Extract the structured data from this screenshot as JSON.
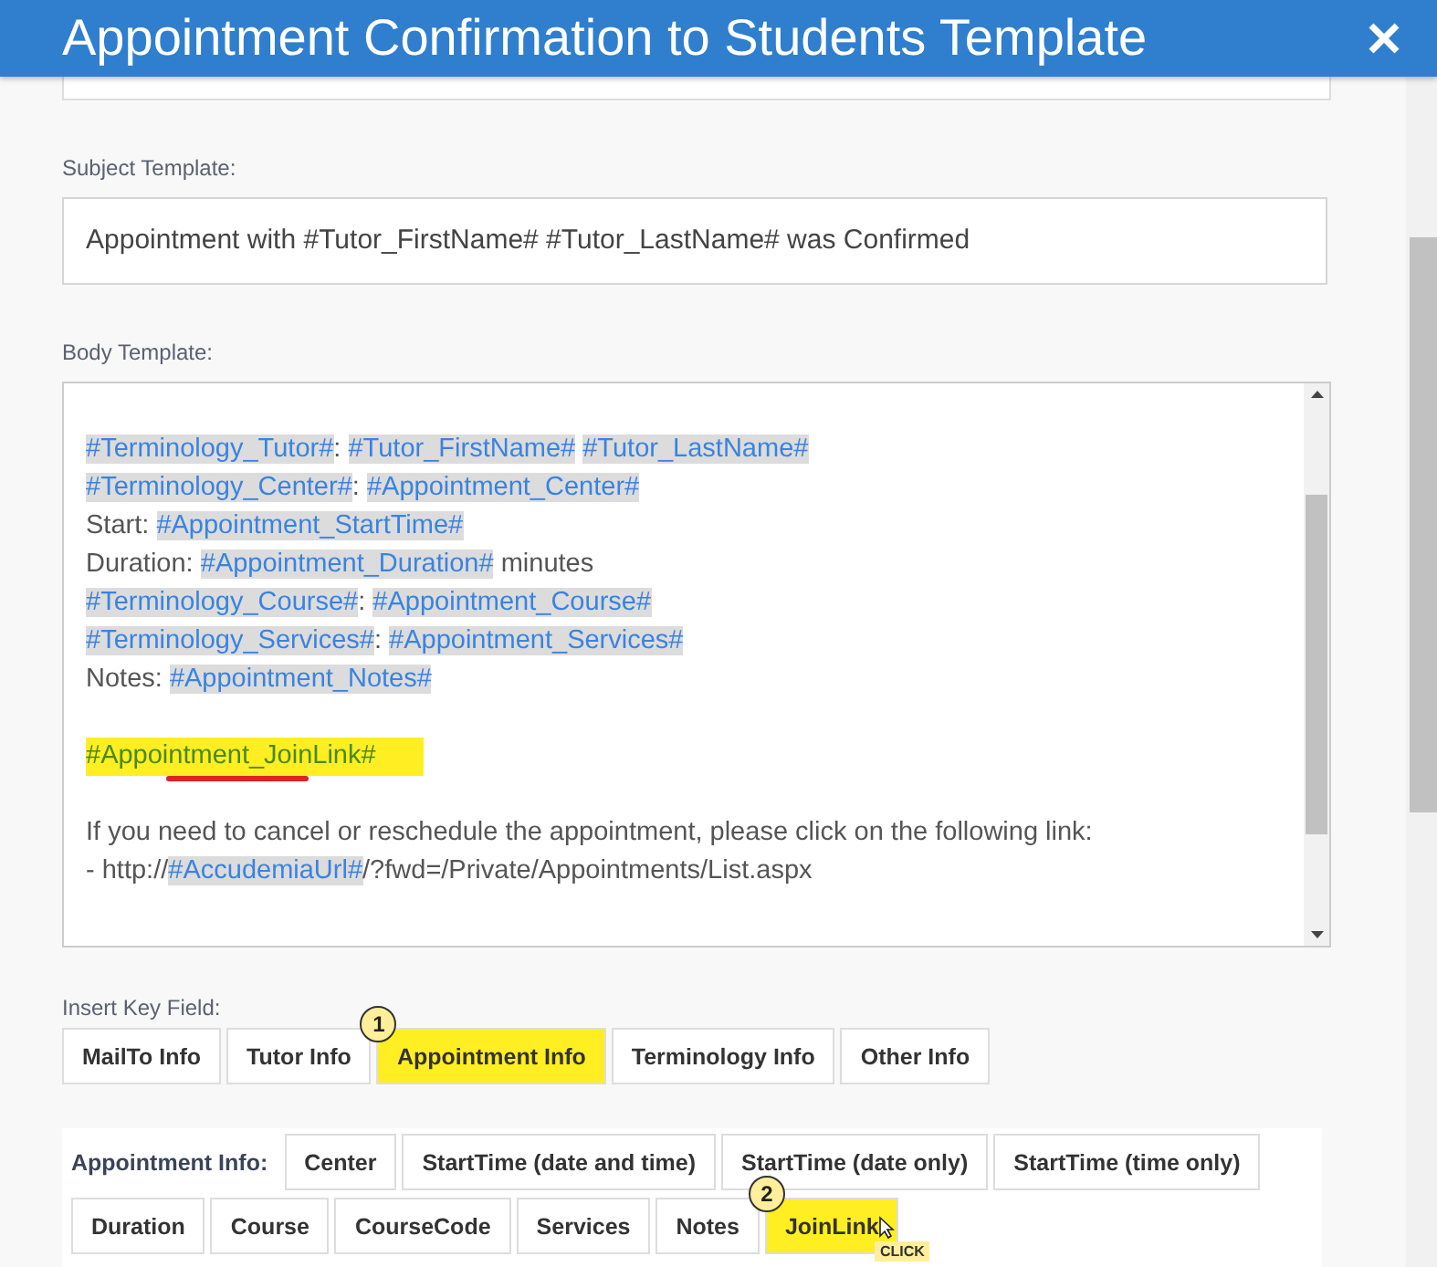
{
  "window": {
    "title": "Appointment Confirmation to Students Template"
  },
  "subject": {
    "label": "Subject Template:",
    "value": "Appointment with #Tutor_FirstName# #Tutor_LastName# was Confirmed"
  },
  "body": {
    "label": "Body Template:",
    "lines": [
      [
        {
          "kind": "token",
          "text": "#Terminology_Tutor#"
        },
        {
          "kind": "text",
          "text": ": "
        },
        {
          "kind": "token",
          "text": "#Tutor_FirstName#"
        },
        {
          "kind": "spaced_token",
          "text": "#Tutor_LastName#"
        }
      ],
      [
        {
          "kind": "token",
          "text": "#Terminology_Center#"
        },
        {
          "kind": "text",
          "text": ": "
        },
        {
          "kind": "token",
          "text": "#Appointment_Center#"
        }
      ],
      [
        {
          "kind": "text",
          "text": "Start: "
        },
        {
          "kind": "token",
          "text": "#Appointment_StartTime#"
        }
      ],
      [
        {
          "kind": "text",
          "text": "Duration: "
        },
        {
          "kind": "token",
          "text": "#Appointment_Duration#"
        },
        {
          "kind": "text",
          "text": " minutes"
        }
      ],
      [
        {
          "kind": "token",
          "text": "#Terminology_Course#"
        },
        {
          "kind": "text",
          "text": ": "
        },
        {
          "kind": "token",
          "text": "#Appointment_Course#"
        }
      ],
      [
        {
          "kind": "token",
          "text": "#Terminology_Services#"
        },
        {
          "kind": "text",
          "text": ": "
        },
        {
          "kind": "token",
          "text": "#Appointment_Services#"
        }
      ],
      [
        {
          "kind": "text",
          "text": "Notes: "
        },
        {
          "kind": "token",
          "text": "#Appointment_Notes#"
        }
      ],
      [
        {
          "kind": "blank"
        }
      ],
      [
        {
          "kind": "marked",
          "text": "#Appointment_JoinLink#"
        }
      ],
      [
        {
          "kind": "blank"
        }
      ],
      [
        {
          "kind": "text",
          "text": "If you need to cancel or reschedule the appointment, please click on the following link:"
        }
      ],
      [
        {
          "kind": "text",
          "text": "- http://"
        },
        {
          "kind": "token",
          "text": "#AccudemiaUrl#"
        },
        {
          "kind": "text",
          "text": "/?fwd=/Private/Appointments/List.aspx"
        }
      ]
    ]
  },
  "insert_key_field": {
    "label": "Insert Key Field:",
    "buttons": [
      {
        "label": "MailTo Info",
        "highlighted": false
      },
      {
        "label": "Tutor Info",
        "highlighted": false
      },
      {
        "label": "Appointment Info",
        "highlighted": true,
        "step": "1"
      },
      {
        "label": "Terminology Info",
        "highlighted": false
      },
      {
        "label": "Other Info",
        "highlighted": false
      }
    ]
  },
  "appointment_info": {
    "label": "Appointment Info:",
    "buttons": [
      {
        "label": "Center",
        "highlighted": false
      },
      {
        "label": "StartTime (date and time)",
        "highlighted": false
      },
      {
        "label": "StartTime (date only)",
        "highlighted": false
      },
      {
        "label": "StartTime (time only)",
        "highlighted": false
      },
      {
        "label": "Duration",
        "highlighted": false
      },
      {
        "label": "Course",
        "highlighted": false
      },
      {
        "label": "CourseCode",
        "highlighted": false
      },
      {
        "label": "Services",
        "highlighted": false
      },
      {
        "label": "Notes",
        "highlighted": false
      },
      {
        "label": "JoinLink",
        "highlighted": true,
        "step": "2",
        "tooltip": "CLICK"
      }
    ]
  }
}
